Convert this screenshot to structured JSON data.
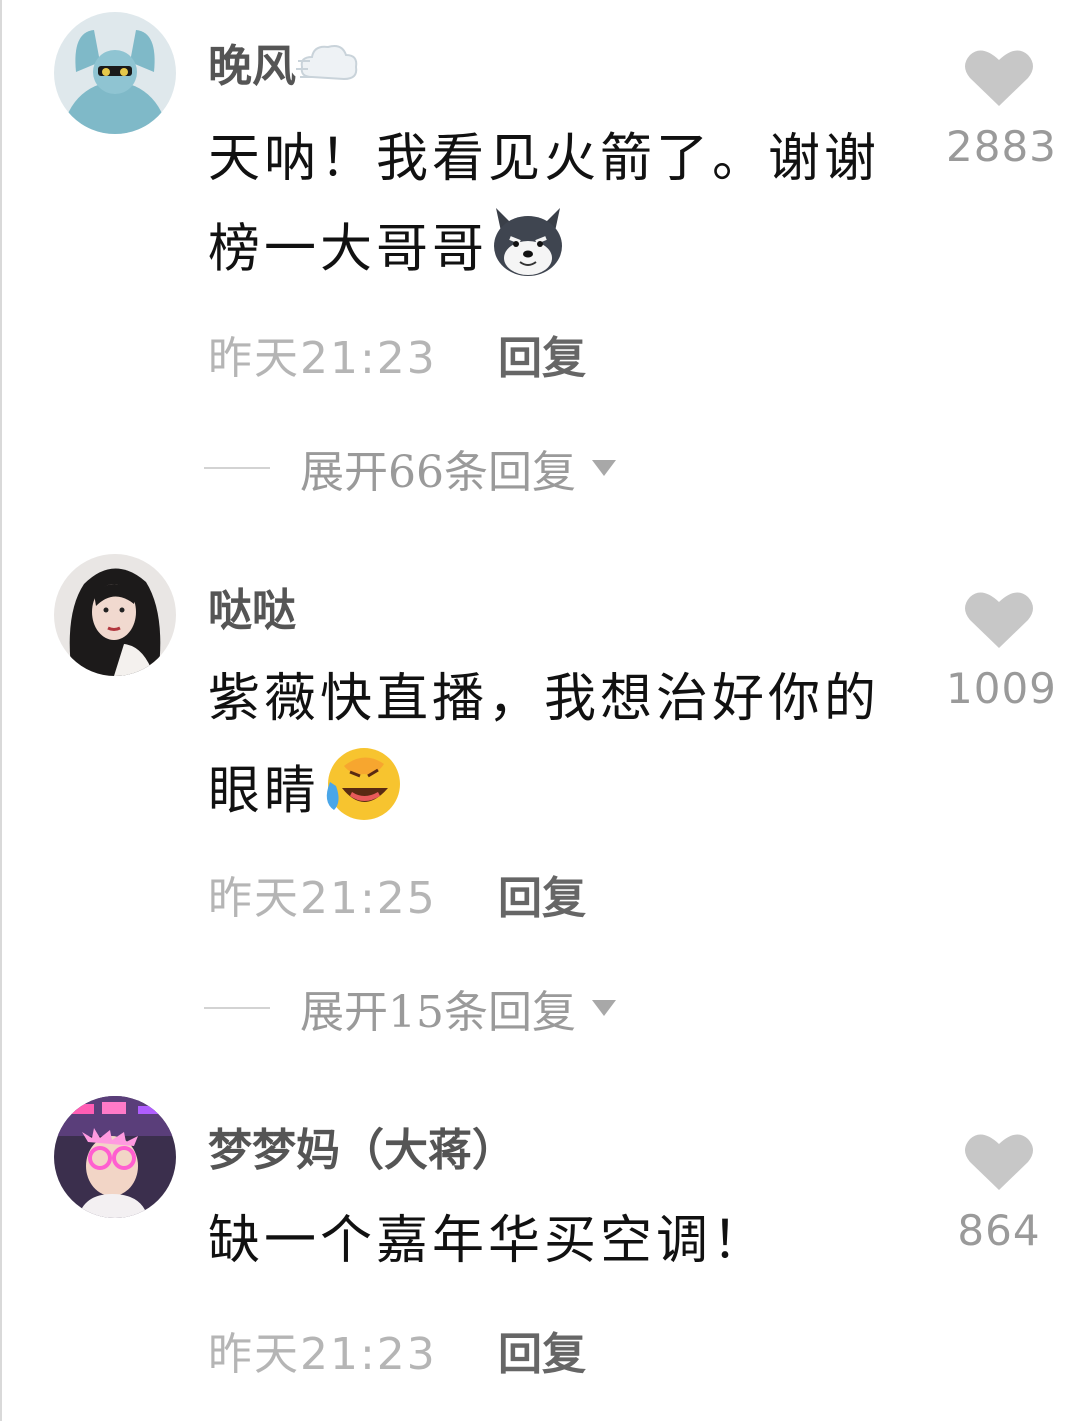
{
  "comments": [
    {
      "username": "晚风",
      "username_emoji": "dash-cloud-emoji",
      "text": "天呐！我看见火箭了。谢谢榜一大哥哥",
      "text_emoji": "husky-dog-emoji",
      "time": "昨天21:23",
      "reply_label": "回复",
      "likes": "2883",
      "expand_label": "展开66条回复"
    },
    {
      "username": "哒哒",
      "text": "紫薇快直播，我想治好你的眼睛",
      "text_emoji": "rolling-laughing-emoji",
      "time": "昨天21:25",
      "reply_label": "回复",
      "likes": "1009",
      "expand_label": "展开15条回复"
    },
    {
      "username": "梦梦妈（大蒋）",
      "text": "缺一个嘉年华买空调！",
      "time": "昨天21:23",
      "reply_label": "回复",
      "likes": "864"
    }
  ],
  "colors": {
    "heart": "#c7c7c7",
    "time": "#b5b5b5",
    "count": "#9a9a9a"
  }
}
